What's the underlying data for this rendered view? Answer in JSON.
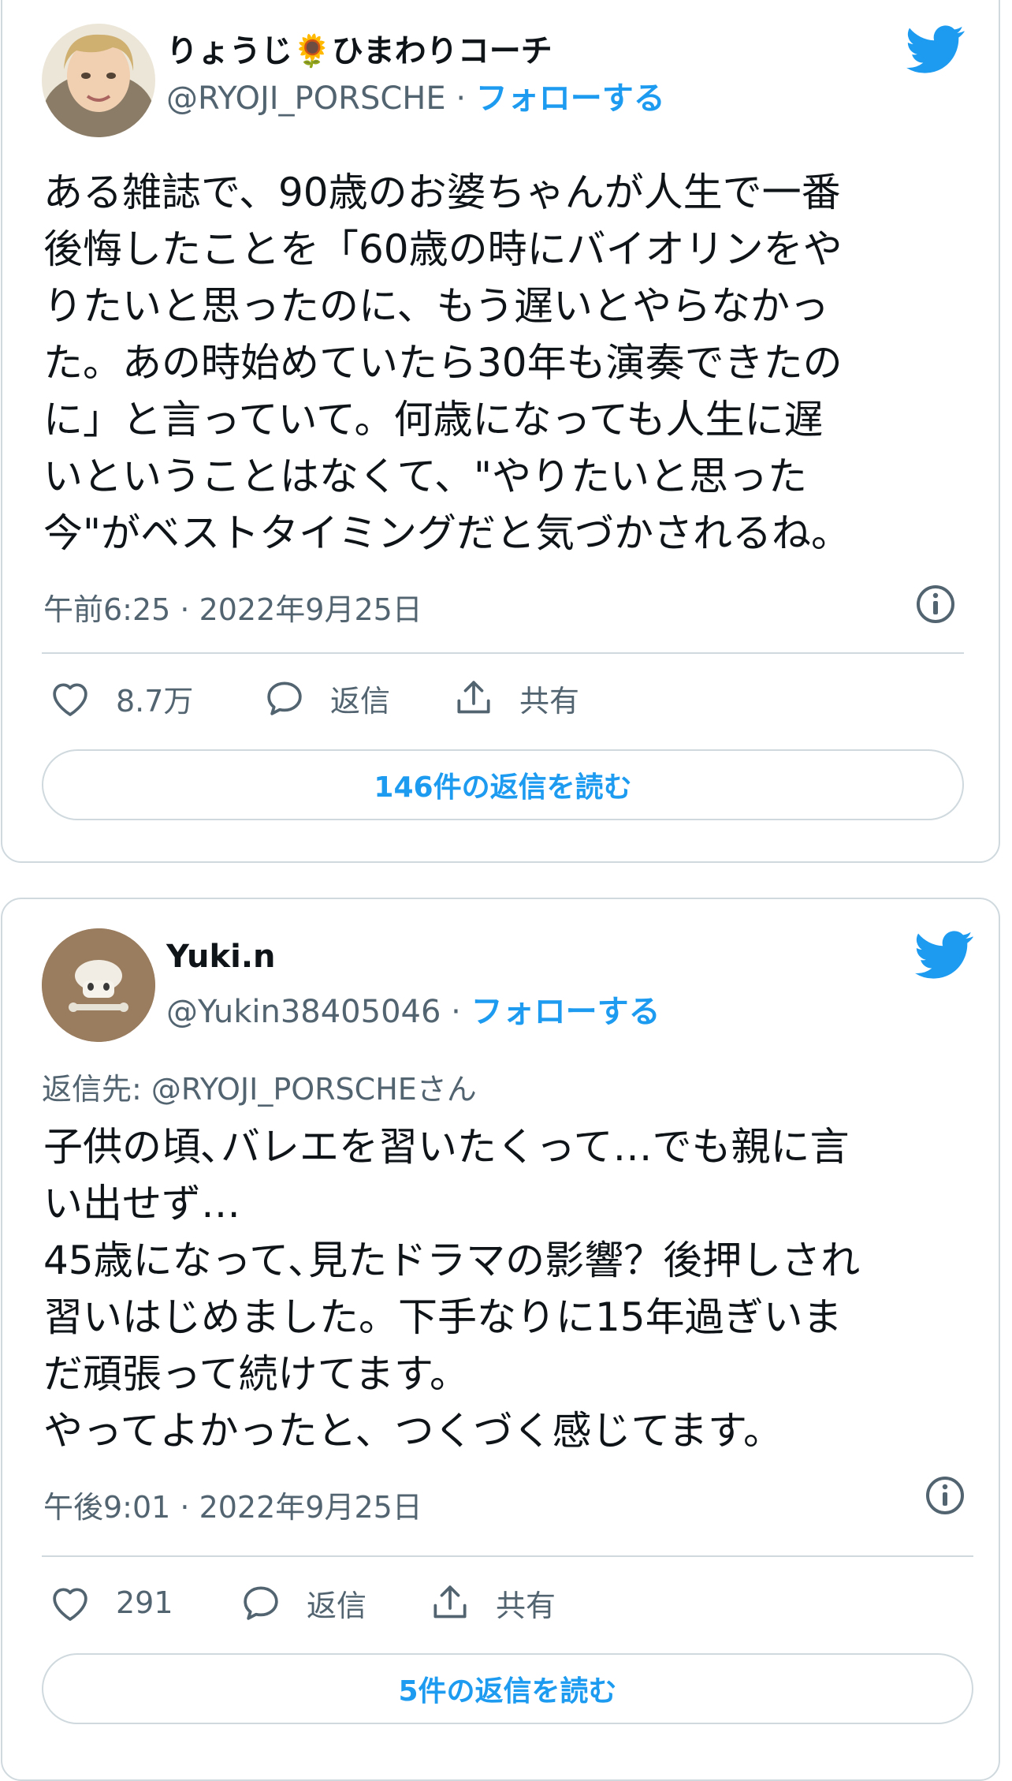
{
  "colors": {
    "accent": "#1d9bf0",
    "text": "#0f1419",
    "secondary": "#536471",
    "border": "#cfd9de"
  },
  "tweets": [
    {
      "display_name_part1": "りょうじ",
      "display_name_emoji": "🌻",
      "display_name_part2": "ひまわりコーチ",
      "handle": "@RYOJI_PORSCHE",
      "separator": "·",
      "follow_label": "フォローする",
      "text": "ある雑誌で、90歳のお婆ちゃんが人生で一番\n後悔したことを「60歳の時にバイオリンをや\nりたいと思ったのに、もう遅いとやらなかっ\nた。あの時始めていたら30年も演奏できたの\nに」と言っていて。何歳になっても人生に遅\nいということはなくて、\"やりたいと思った\n今\"がベストタイミングだと気づかされるね。",
      "timestamp": "午前6:25 · 2022年9月25日",
      "likes": "8.7万",
      "reply_label": "返信",
      "share_label": "共有",
      "read_replies_label": "146件の返信を読む",
      "icons": [
        "avatar",
        "twitter-bird-icon",
        "info-icon",
        "heart-icon",
        "reply-icon",
        "share-icon"
      ]
    },
    {
      "display_name": "Yuki.n",
      "handle": "@Yukin38405046",
      "separator": "·",
      "follow_label": "フォローする",
      "reply_to": "返信先: @RYOJI_PORSCHEさん",
      "text": "子供の頃､バレエを習いたくって…でも親に言\nい出せず…\n45歳になって､見たドラマの影響？後押しされ\n習いはじめました。下手なりに15年過ぎいま\nだ頑張って続けてます。\nやってよかったと、つくづく感じてます。",
      "timestamp": "午後9:01 · 2022年9月25日",
      "likes": "291",
      "reply_label": "返信",
      "share_label": "共有",
      "read_replies_label": "5件の返信を読む",
      "icons": [
        "avatar",
        "twitter-bird-icon",
        "info-icon",
        "heart-icon",
        "reply-icon",
        "share-icon"
      ]
    }
  ]
}
